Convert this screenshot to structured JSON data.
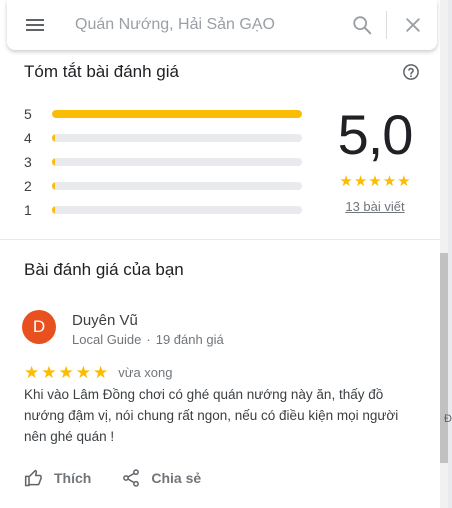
{
  "search": {
    "placeholder": "Quán Nướng, Hải Sản GẠO",
    "value": ""
  },
  "icons": {
    "menu": "hamburger-menu-icon",
    "search": "search-icon",
    "close": "close-icon",
    "help": "help-circle-icon",
    "like": "thumbs-up-icon",
    "share": "share-icon"
  },
  "summary": {
    "title": "Tóm tắt bài đánh giá",
    "rows": [
      {
        "label": "5",
        "fraction": 1.0
      },
      {
        "label": "4",
        "fraction": 0.0
      },
      {
        "label": "3",
        "fraction": 0.0
      },
      {
        "label": "2",
        "fraction": 0.0
      },
      {
        "label": "1",
        "fraction": 0.0
      }
    ],
    "score": "5,0",
    "stars": 5,
    "review_count": "13 bài viết"
  },
  "your_review": {
    "title": "Bài đánh giá của bạn",
    "avatar_letter": "D",
    "avatar_color": "#e8501f",
    "name": "Duyên Vũ",
    "badge": "Local Guide",
    "separator": "·",
    "review_count": "19 đánh giá",
    "rating": 5,
    "time": "vừa xong",
    "text": "Khi vào Lâm Đồng chơi có ghé quán nướng này ăn, thấy đồ nướng đậm vị, nói chung rất ngon, nếu có điều kiện mọi người nên ghé quán !",
    "like_label": "Thích",
    "share_label": "Chia sẻ"
  },
  "map_glimpse": "Đ",
  "colors": {
    "star": "#fbbc04",
    "bar_track": "#e8eaed",
    "text_primary": "#202124",
    "text_secondary": "#70757a"
  }
}
